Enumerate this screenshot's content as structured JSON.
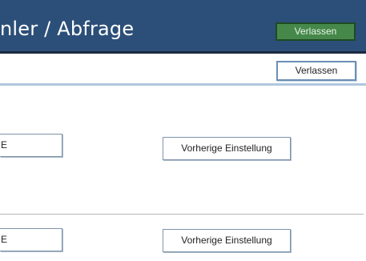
{
  "header": {
    "title": "nler / Abfrage",
    "exit_label": "Verlassen"
  },
  "toolbar": {
    "exit_label": "Verlassen"
  },
  "sections": [
    {
      "field_value": "E",
      "prev_button_label": "Vorherige Einstellung"
    },
    {
      "field_value": "E",
      "prev_button_label": "Vorherige Einstellung"
    }
  ],
  "colors": {
    "header_bg": "#2c4f79",
    "exit_green": "#46884a",
    "toolbar_accent": "#b0c7de"
  }
}
